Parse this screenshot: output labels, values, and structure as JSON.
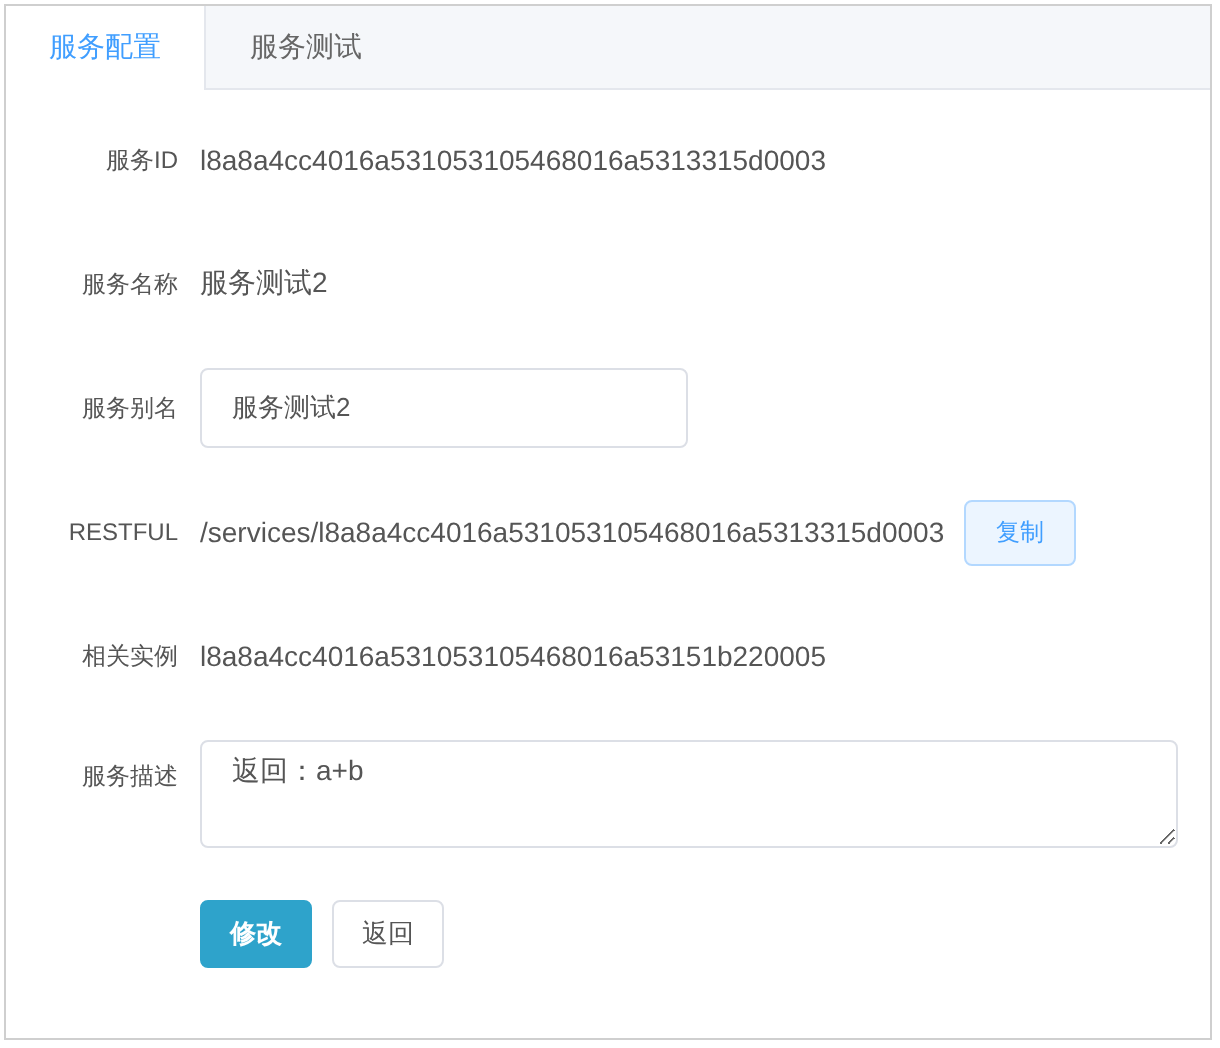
{
  "tabs": [
    {
      "label": "服务配置",
      "selected": true
    },
    {
      "label": "服务测试",
      "selected": false
    }
  ],
  "fields": [
    {
      "kind": "text",
      "label": "服务ID",
      "value": "l8a8a4cc4016a531053105468016a5313315d0003"
    },
    {
      "kind": "text",
      "label": "服务名称",
      "value": "服务测试2"
    },
    {
      "kind": "input",
      "label": "服务别名",
      "value": "服务测试2"
    },
    {
      "kind": "link",
      "label": "RESTFUL",
      "value": "/services/l8a8a4cc4016a531053105468016a5313315d0003",
      "button": "复制"
    },
    {
      "kind": "text",
      "label": "相关实例",
      "value": "l8a8a4cc4016a531053105468016a53151b220005"
    },
    {
      "kind": "textarea",
      "label": "服务描述",
      "value": "返回：a+b"
    }
  ],
  "buttons": [
    {
      "kind": "primary",
      "label": "修改"
    },
    {
      "kind": "default",
      "label": "返回"
    }
  ]
}
